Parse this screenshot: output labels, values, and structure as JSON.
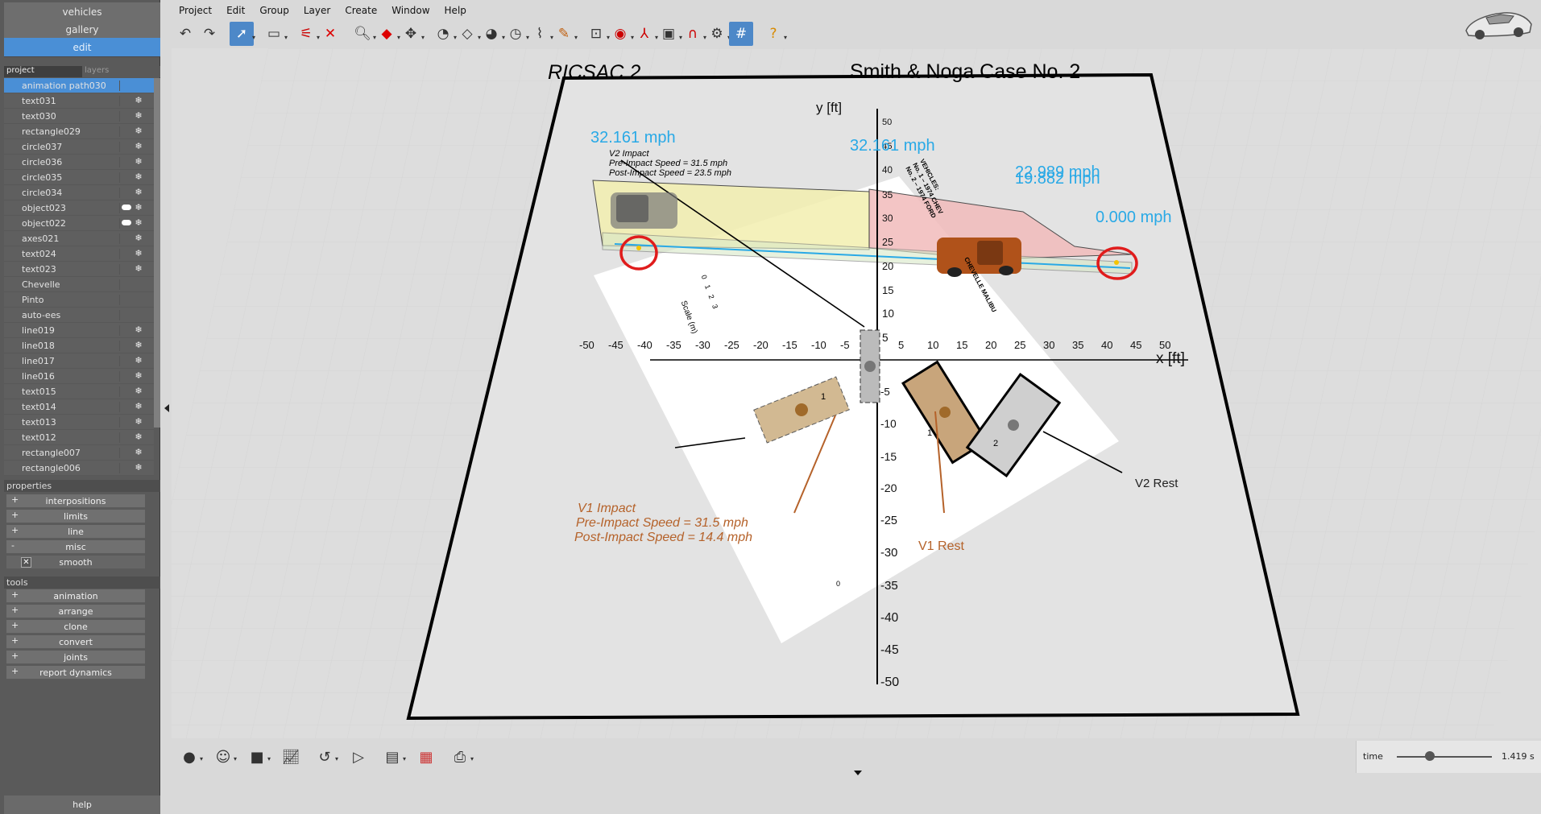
{
  "left_panel": {
    "top_buttons": [
      "vehicles",
      "gallery",
      "edit"
    ],
    "tabs": [
      "project",
      "layers"
    ],
    "project_items": [
      {
        "label": "animation path030",
        "selected": true,
        "eye": false,
        "gear": false
      },
      {
        "label": "text031",
        "eye": false,
        "gear": true
      },
      {
        "label": "text030",
        "eye": false,
        "gear": true
      },
      {
        "label": "rectangle029",
        "eye": false,
        "gear": true
      },
      {
        "label": "circle037",
        "eye": false,
        "gear": true
      },
      {
        "label": "circle036",
        "eye": false,
        "gear": true
      },
      {
        "label": "circle035",
        "eye": false,
        "gear": true
      },
      {
        "label": "circle034",
        "eye": false,
        "gear": true
      },
      {
        "label": "object023",
        "eye": true,
        "gear": true
      },
      {
        "label": "object022",
        "eye": true,
        "gear": true
      },
      {
        "label": "axes021",
        "eye": false,
        "gear": true
      },
      {
        "label": "text024",
        "eye": false,
        "gear": true
      },
      {
        "label": "text023",
        "eye": false,
        "gear": true
      },
      {
        "label": "Chevelle",
        "eye": false,
        "gear": false
      },
      {
        "label": "Pinto",
        "eye": false,
        "gear": false
      },
      {
        "label": "auto-ees",
        "eye": false,
        "gear": false
      },
      {
        "label": "line019",
        "eye": false,
        "gear": true
      },
      {
        "label": "line018",
        "eye": false,
        "gear": true
      },
      {
        "label": "line017",
        "eye": false,
        "gear": true
      },
      {
        "label": "line016",
        "eye": false,
        "gear": true
      },
      {
        "label": "text015",
        "eye": false,
        "gear": true
      },
      {
        "label": "text014",
        "eye": false,
        "gear": true
      },
      {
        "label": "text013",
        "eye": false,
        "gear": true
      },
      {
        "label": "text012",
        "eye": false,
        "gear": true
      },
      {
        "label": "rectangle007",
        "eye": false,
        "gear": true
      },
      {
        "label": "rectangle006",
        "eye": false,
        "gear": true
      }
    ],
    "properties_label": "properties",
    "properties": [
      {
        "sign": "+",
        "label": "interpositions"
      },
      {
        "sign": "+",
        "label": "limits"
      },
      {
        "sign": "+",
        "label": "line"
      },
      {
        "sign": "-",
        "label": "misc"
      }
    ],
    "smooth_label": "smooth",
    "smooth_checked": true,
    "tools_label": "tools",
    "tools": [
      {
        "sign": "+",
        "label": "animation"
      },
      {
        "sign": "+",
        "label": "arrange"
      },
      {
        "sign": "+",
        "label": "clone"
      },
      {
        "sign": "+",
        "label": "convert"
      },
      {
        "sign": "+",
        "label": "joints"
      },
      {
        "sign": "+",
        "label": "report dynamics"
      }
    ],
    "help_label": "help"
  },
  "menu": [
    "Project",
    "Edit",
    "Group",
    "Layer",
    "Create",
    "Window",
    "Help"
  ],
  "toolbar_icons": [
    "undo-icon",
    "redo-icon",
    "select-pointer-icon",
    "rectangle-select-icon",
    "unlink-icon",
    "delete-icon",
    "zoom-icon",
    "3d-cube-icon",
    "pan-icon",
    "measure-dial-icon",
    "surface-icon",
    "gauge-icon",
    "speedometer-icon",
    "spring-icon",
    "pencil-icon",
    "camera-target-icon",
    "target-icon",
    "axes-icon",
    "texture-icon",
    "magnet-icon",
    "gear-settings-icon",
    "grid-icon",
    "help-icon"
  ],
  "scene": {
    "title_left": "RICSAC 2",
    "title_right": "Smith & Noga Case No. 2",
    "y_axis_label": "y [ft]",
    "x_axis_label": "x [ft]",
    "x_ticks": [
      "-50",
      "-45",
      "-40",
      "-35",
      "-30",
      "-25",
      "-20",
      "-15",
      "-10",
      "-5",
      "5",
      "10",
      "15",
      "20",
      "25",
      "30",
      "35",
      "40",
      "45",
      "50"
    ],
    "y_ticks_pos": [
      "50",
      "45",
      "40",
      "35",
      "30",
      "25",
      "20",
      "15",
      "10",
      "5"
    ],
    "y_ticks_neg": [
      "-5",
      "-10",
      "-15",
      "-20",
      "-25",
      "-30",
      "-35",
      "-40",
      "-45",
      "-50"
    ],
    "speed_labels": [
      "32.161 mph",
      "32.161 mph",
      "22.989 mph",
      "19.882 mph",
      "0.000 mph"
    ],
    "v2_impact_lines": [
      "V2 Impact",
      "Pre-Impact Speed = 31.5 mph",
      "Post-Impact Speed = 23.5 mph"
    ],
    "v1_impact_lines": [
      "V1 Impact",
      "Pre-Impact Speed = 31.5 mph",
      "Post-Impact Speed = 14.4 mph"
    ],
    "v1_rest": "V1 Rest",
    "v2_rest": "V2 Rest",
    "scale_label": "Scale (m)",
    "scale_ticks": [
      "0",
      "1",
      "2",
      "3"
    ],
    "vehicle_note_lines": [
      "VEHICLES:",
      "No. 1 – 1974 CHEV",
      "No. 2 – 1974 FORD"
    ],
    "malibu_label": "CHEVELLE MALIBU",
    "small_zero": "0",
    "vehicle_box_labels": [
      "1",
      "1",
      "2"
    ],
    "colors": {
      "speed_text": "#29a9e6",
      "annotation_brown": "#b5622a",
      "rest_circle": "#e01c1c"
    }
  },
  "bottom_icons": [
    "sphere-icon",
    "head-icon",
    "square-icon",
    "graph-icon",
    "path-icon",
    "play-icon",
    "frames-icon",
    "report-icon",
    "print-icon"
  ],
  "time": {
    "label": "time",
    "value": "1.419 s",
    "fraction": 0.35
  }
}
